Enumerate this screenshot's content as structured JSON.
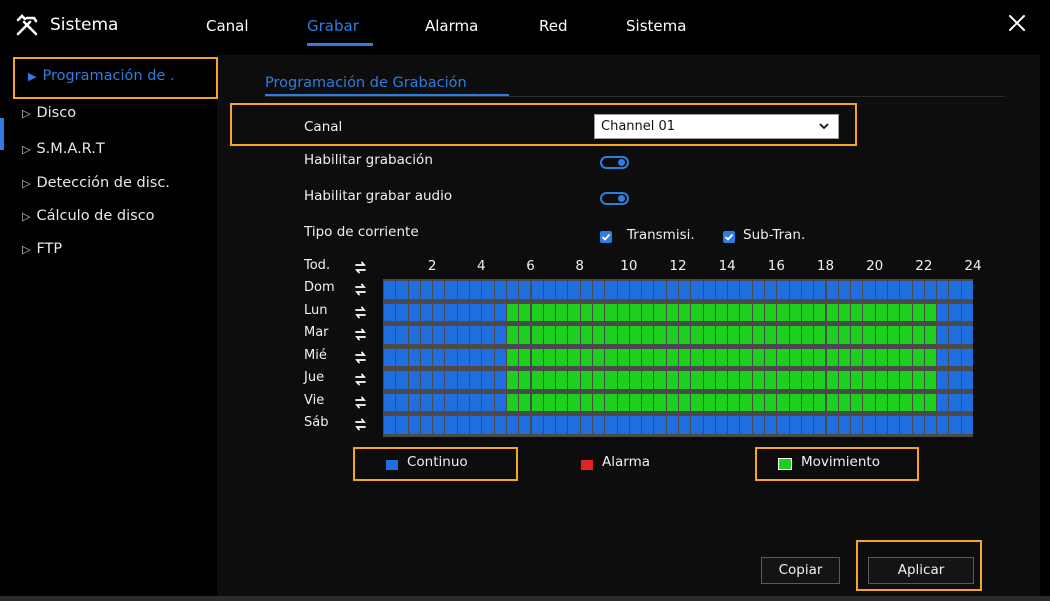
{
  "header": {
    "brand_label": "Sistema",
    "tabs": [
      {
        "label": "Canal",
        "active": false
      },
      {
        "label": "Grabar",
        "active": true
      },
      {
        "label": "Alarma",
        "active": false
      },
      {
        "label": "Red",
        "active": false
      },
      {
        "label": "Sistema",
        "active": false
      }
    ],
    "close_icon": "close-icon"
  },
  "sidebar": {
    "items": [
      {
        "label": "Programación de .",
        "active": true
      },
      {
        "label": "Disco",
        "active": false
      },
      {
        "label": "S.M.A.R.T",
        "active": false
      },
      {
        "label": "Detección de disc.",
        "active": false
      },
      {
        "label": "Cálculo de disco",
        "active": false
      },
      {
        "label": "FTP",
        "active": false
      }
    ]
  },
  "main": {
    "subtab": "Programación de Grabación",
    "canal_label": "Canal",
    "canal_value": "Channel 01",
    "enable_record_label": "Habilitar grabación",
    "enable_record": true,
    "enable_audio_label": "Habilitar grabar audio",
    "enable_audio": true,
    "stream_type_label": "Tipo de corriente",
    "stream_options": [
      {
        "label": "Transmisi.",
        "checked": true
      },
      {
        "label": "Sub-Tran.",
        "checked": true
      }
    ]
  },
  "schedule": {
    "all_label": "Tod.",
    "hour_labels": [
      "2",
      "4",
      "6",
      "8",
      "10",
      "12",
      "14",
      "16",
      "18",
      "20",
      "22",
      "24"
    ],
    "days": [
      "Dom",
      "Lun",
      "Mar",
      "Mié",
      "Jue",
      "Vie",
      "Sáb"
    ],
    "rows": [
      "cccccccccccccccccccccccccccccccccccccccccccccccc",
      "ccccccccccccmmmmmmmmmmmmmmmmmmmmmmmmmmmmmmmmmmmmmmmmmmmcccc",
      "ccccccccccccmmmmmmmmmmmmmmmmmmmmmmmmmmmmmmmmmmmmmmmmmmmcccc",
      "ccccccccccccmmmmmmmmmmmmmmmmmmmmmmmmmmmmmmmmmmmmmmmmmmmcccc",
      "ccccccccccccmmmmmmmmmmmmmmmmmmmmmmmmmmmmmmmmmmmmmmmmmmmcccc",
      "ccccccccccccmmmmmmmmmmmmmmmmmmmmmmmmmmmmmmmmmmmmmmmmmmmcccc",
      "cccccccccccccccccccccccccccccccccccccccccccccccc"
    ],
    "colors": {
      "continuo": "#1f6fe0",
      "alarma": "#e02424",
      "movimiento": "#1ed01e"
    }
  },
  "legend": {
    "continuo": "Continuo",
    "alarma": "Alarma",
    "movimiento": "Movimiento"
  },
  "footer": {
    "copy_label": "Copiar",
    "apply_label": "Aplicar"
  }
}
